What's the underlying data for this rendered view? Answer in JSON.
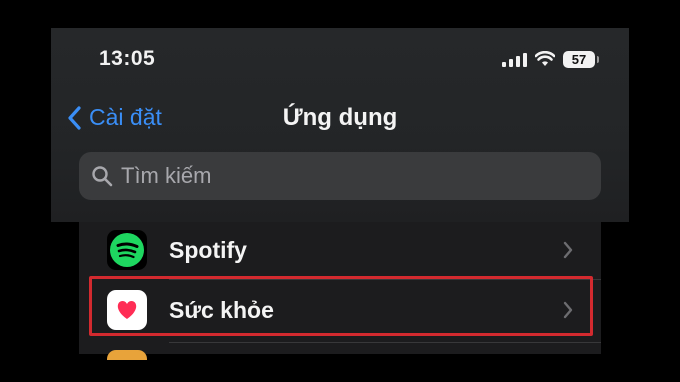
{
  "status_bar": {
    "time": "13:05",
    "battery_level": "57"
  },
  "nav": {
    "back_label": "Cài đặt",
    "title": "Ứng dụng"
  },
  "search": {
    "placeholder": "Tìm kiếm"
  },
  "apps": [
    {
      "label": "Spotify",
      "icon": "spotify-icon",
      "icon_color": "#1ed760"
    },
    {
      "label": "Sức khỏe",
      "icon": "health-heart-icon",
      "icon_color": "#ff2d55"
    }
  ],
  "colors": {
    "accent": "#3a8ef6",
    "highlight": "#d32a2f"
  }
}
